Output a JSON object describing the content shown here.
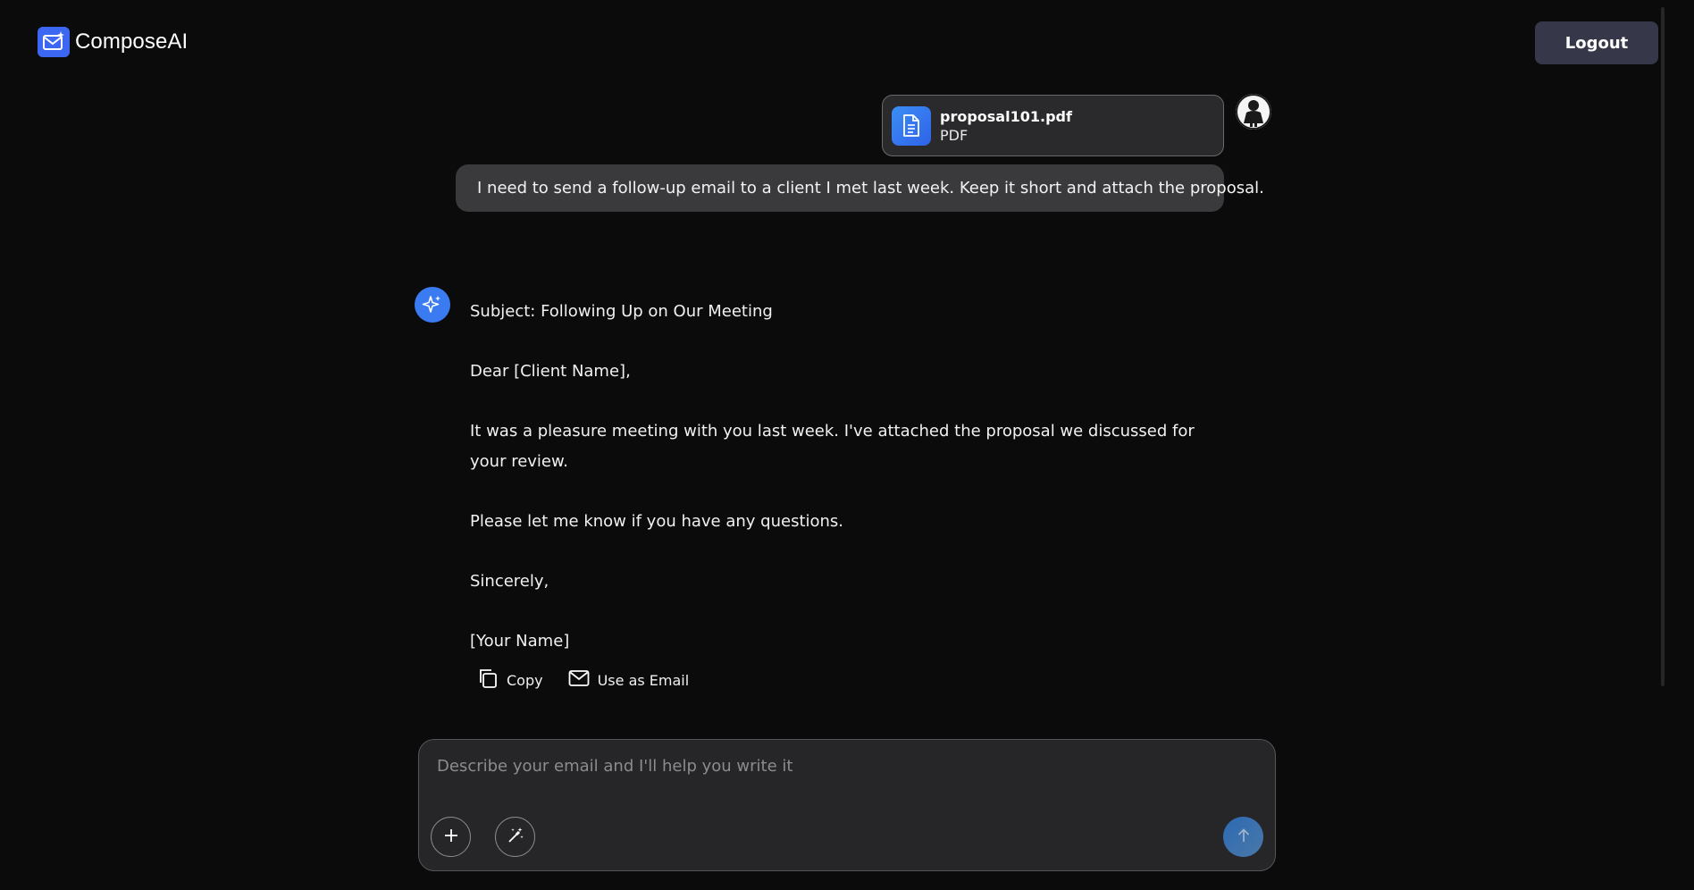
{
  "app": {
    "brand_name": "ComposeAI",
    "logout_label": "Logout",
    "accent_color": "#3b67f2"
  },
  "user_message": {
    "attachment": {
      "file_name": "proposal101.pdf",
      "file_type": "PDF",
      "icon": "document-icon"
    },
    "text": "I need to send a follow-up email to a client I met last week. Keep it short and attach the proposal.",
    "avatar_icon": "user-avatar"
  },
  "assistant_message": {
    "avatar_icon": "sparkle-icon",
    "paragraphs": [
      "Subject: Following Up on Our Meeting",
      "Dear [Client Name],",
      "It was a pleasure meeting with you last week.  I've attached the proposal we discussed for your review.",
      "Please let me know if you have any questions.",
      "Sincerely,",
      "[Your Name]"
    ],
    "actions": {
      "copy_label": "Copy",
      "use_email_label": "Use as Email"
    }
  },
  "composer": {
    "placeholder": "Describe your email and I'll help you write it",
    "value": ""
  }
}
